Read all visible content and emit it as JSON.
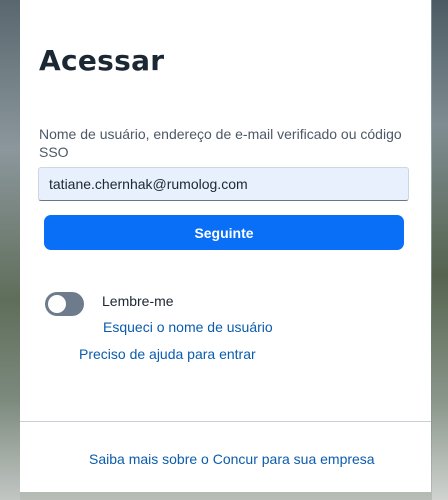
{
  "login": {
    "title": "Acessar",
    "username_label": "Nome de usuário, endereço de e-mail verificado ou código SSO",
    "username_value": "tatiane.chernhak@rumolog.com",
    "next_button": "Seguinte",
    "remember_me": {
      "label": "Lembre-me",
      "checked": false
    },
    "forgot_username_link": "Esqueci o nome de usuário",
    "help_link": "Preciso de ajuda para entrar"
  },
  "footer": {
    "learn_more_link": "Saiba mais sobre o Concur para sua empresa"
  },
  "colors": {
    "primary_button": "#0a6ff7",
    "link": "#0b5cad",
    "input_background": "#e8f0fe",
    "toggle_off": "#6d7b8c",
    "title_text": "#1b2733"
  },
  "icons": {
    "toggle": "toggle-switch-off"
  }
}
